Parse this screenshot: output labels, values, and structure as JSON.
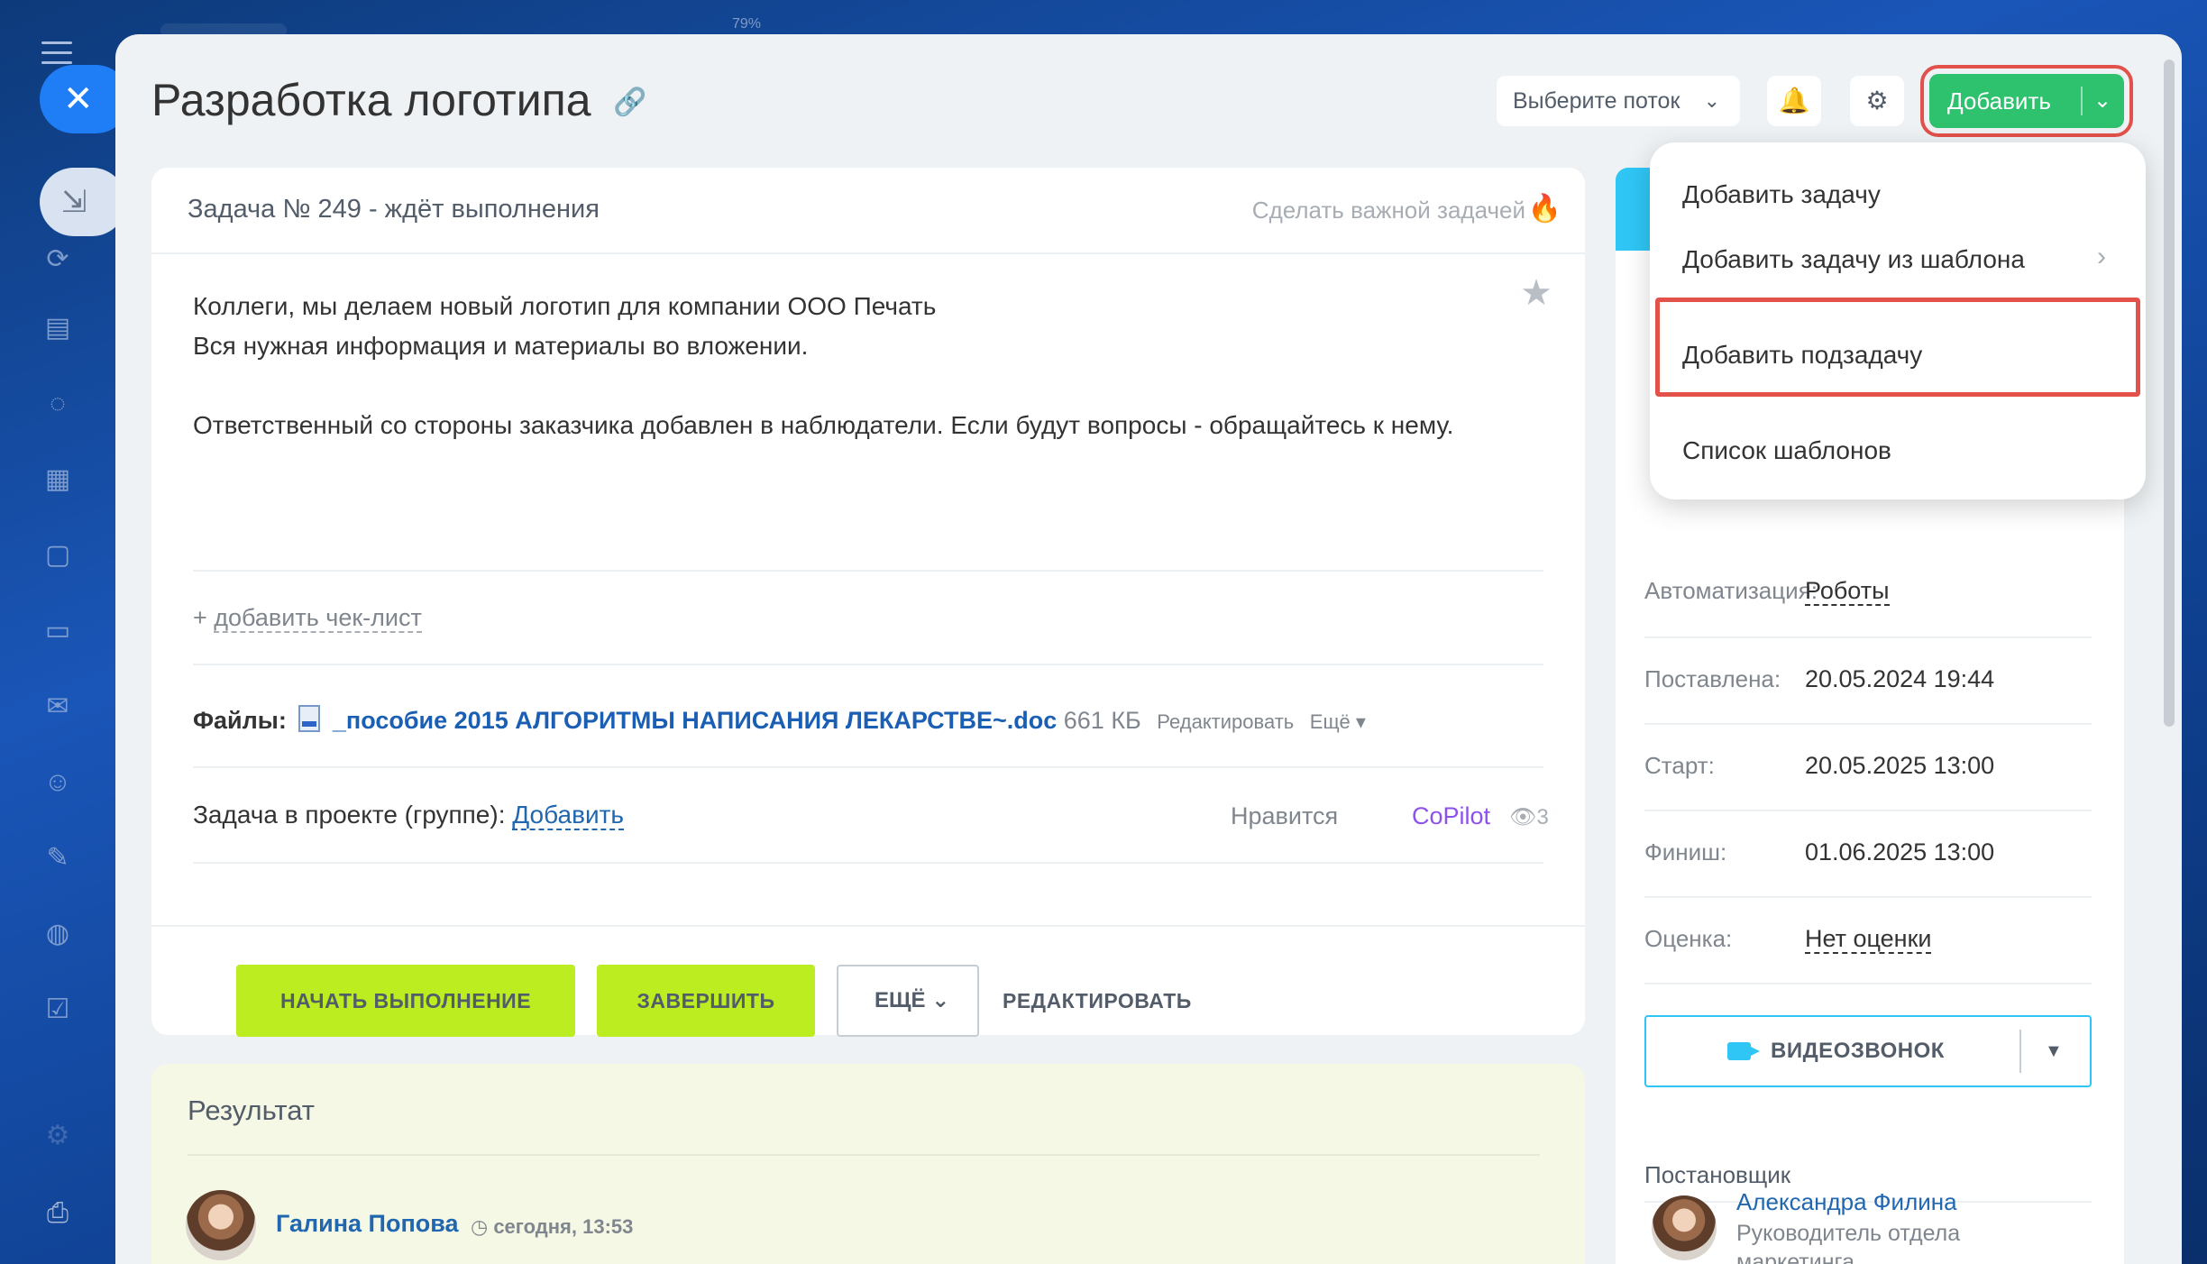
{
  "window": {
    "zoom": "79%"
  },
  "leftbar": {
    "icons": [
      "menu-icon",
      "close-icon",
      "collapse-icon",
      "home-icon",
      "flow-icon",
      "document-icon",
      "chat-icon",
      "calendar-icon",
      "file-icon",
      "drive-icon",
      "mail-icon",
      "contacts-icon",
      "sign-icon",
      "robot-icon",
      "checklist-icon",
      "settings-icon",
      "printer-icon"
    ]
  },
  "header": {
    "title": "Разработка логотипа",
    "flow_select": "Выберите поток",
    "add_button": "Добавить"
  },
  "task": {
    "number_status": "Задача № 249 - ждёт выполнения",
    "make_important": "Сделать важной задачей",
    "description_lines": [
      "Коллеги, мы делаем новый логотип для компании ООО Печать",
      "Вся нужная информация и материалы во вложении.",
      "",
      "Ответственный со стороны заказчика добавлен в наблюдатели. Если будут вопросы - обращайтесь к нему."
    ],
    "add_checklist_prefix": "+ ",
    "add_checklist": "добавить чек-лист",
    "files_label": "Файлы:",
    "file_name": "_пособие 2015 АЛГОРИТМЫ НАПИСАНИЯ ЛЕКАРСТВЕ~.doc",
    "file_size": "661 КБ",
    "file_edit": "Редактировать",
    "file_more": "Ещё",
    "project_label": "Задача в проекте (группе):",
    "project_add": "Добавить",
    "likes": "Нравится",
    "copilot": "CoPilot",
    "views": "3",
    "btn_start": "НАЧАТЬ ВЫПОЛНЕНИЕ",
    "btn_finish": "ЗАВЕРШИТЬ",
    "btn_more": "ЕЩЁ",
    "btn_edit": "РЕДАКТИРОВАТЬ"
  },
  "result": {
    "title": "Результат",
    "author": "Галина Попова",
    "time": "сегодня, 13:53"
  },
  "side": {
    "automation_label": "Автоматизация:",
    "automation_value": "Роботы",
    "created_label": "Поставлена:",
    "created_value": "20.05.2024 19:44",
    "start_label": "Старт:",
    "start_value": "20.05.2025 13:00",
    "finish_label": "Финиш:",
    "finish_value": "01.06.2025 13:00",
    "rating_label": "Оценка:",
    "rating_value": "Нет оценки",
    "video_call": "ВИДЕОЗВОНОК",
    "creator_title": "Постановщик",
    "creator_name": "Александра Филина",
    "creator_role": "Руководитель отдела маркетинга"
  },
  "menu": {
    "items": [
      "Добавить задачу",
      "Добавить задачу из шаблона",
      "Добавить подзадачу",
      "Список шаблонов"
    ]
  },
  "colors": {
    "accent_green": "#2fc26e",
    "action_lime": "#bbed21",
    "highlight_red": "#e2514a",
    "link_blue": "#2067b0",
    "video_cyan": "#2fc6f6"
  }
}
